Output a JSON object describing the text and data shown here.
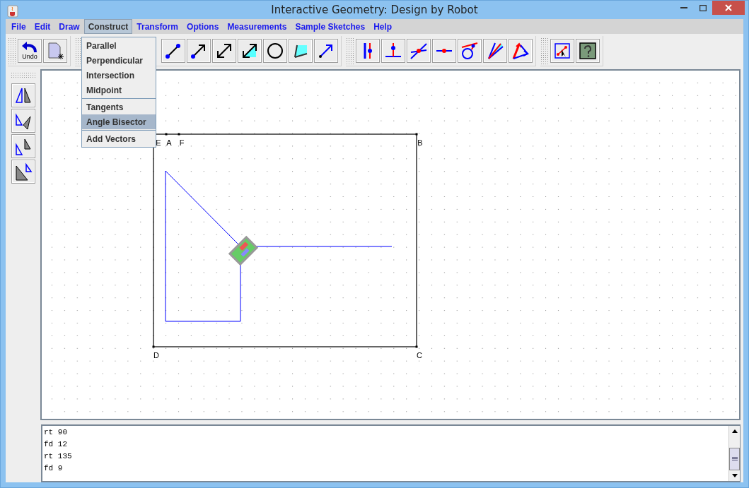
{
  "window": {
    "title": "Interactive Geometry: Design by Robot"
  },
  "menu": [
    {
      "label": "File",
      "selected": false
    },
    {
      "label": "Edit",
      "selected": false
    },
    {
      "label": "Draw",
      "selected": false
    },
    {
      "label": "Construct",
      "selected": true
    },
    {
      "label": "Transform",
      "selected": false
    },
    {
      "label": "Options",
      "selected": false
    },
    {
      "label": "Measurements",
      "selected": false
    },
    {
      "label": "Sample Sketches",
      "selected": false
    },
    {
      "label": "Help",
      "selected": false
    }
  ],
  "dropdown": {
    "sections": [
      {
        "items": [
          {
            "label": "Parallel",
            "selected": false
          },
          {
            "label": "Perpendicular",
            "selected": false
          },
          {
            "label": "Intersection",
            "selected": false
          },
          {
            "label": "Midpoint",
            "selected": false
          }
        ]
      },
      {
        "items": [
          {
            "label": "Tangents",
            "selected": false
          },
          {
            "label": "Angle Bisector",
            "selected": true
          }
        ]
      },
      {
        "items": [
          {
            "label": "Add Vectors",
            "selected": false
          }
        ]
      }
    ]
  },
  "toolbar": {
    "undo_label": "Undo"
  },
  "canvas": {
    "point_labels": [
      "E",
      "A",
      "F",
      "B",
      "D",
      "C"
    ]
  },
  "console": {
    "lines": [
      "rt 90",
      "fd 12",
      "rt 135",
      "fd 9"
    ]
  }
}
